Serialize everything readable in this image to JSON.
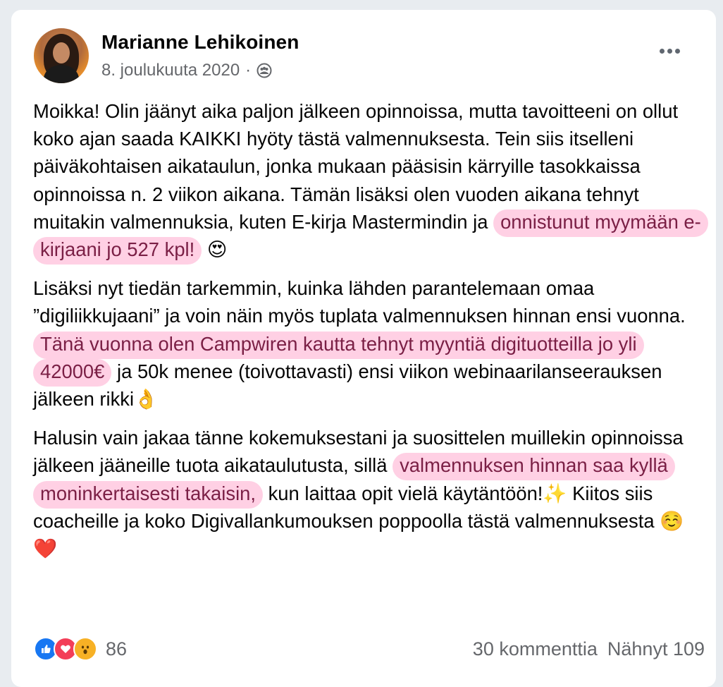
{
  "post": {
    "author": "Marianne Lehikoinen",
    "date": "8. joulukuuta 2020",
    "separator": "·",
    "audience_icon": "group-audience-icon",
    "more_icon": "more-options-icon",
    "paragraphs": [
      {
        "segments": [
          {
            "text": "Moikka! Olin jäänyt aika paljon jälkeen opinnoissa, mutta tavoitteeni on ollut koko ajan saada KAIKKI hyöty tästä valmennuksesta. Tein siis itselleni päiväkohtaisen aikataulun, jonka mukaan pääsisin kärryille tasokkaissa opinnoissa n. 2 viikon aikana. Tämän lisäksi olen vuoden aikana tehnyt muitakin valmennuksia, kuten E-kirja Mastermindin ja "
          },
          {
            "text": "onnistunut myymään e-kirjaani jo 527 kpl!",
            "highlight": true
          },
          {
            "text": " 😍"
          }
        ]
      },
      {
        "segments": [
          {
            "text": "Lisäksi nyt tiedän tarkemmin, kuinka lähden parantelemaan omaa ”digiliikkujaani” ja voin näin myös tuplata valmennuksen hinnan ensi vuonna. "
          },
          {
            "text": "Tänä vuonna olen Campwiren kautta tehnyt myyntiä digituotteilla jo yli 42000€",
            "highlight": true
          },
          {
            "text": " ja 50k menee (toivottavasti) ensi viikon webinaarilanseerauksen jälkeen rikki👌"
          }
        ]
      },
      {
        "segments": [
          {
            "text": "Halusin vain jakaa tänne kokemuksestani ja suosittelen muillekin opinnoissa jälkeen jääneille tuota aikataulutusta, sillä "
          },
          {
            "text": "valmennuksen hinnan saa kyllä moninkertaisesti takaisin,",
            "highlight": true
          },
          {
            "text": " kun laittaa opit vielä käytäntöön!✨ Kiitos siis coacheille ja koko Digivallankumouksen poppoolla tästä valmennuksesta ☺️❤️"
          }
        ]
      }
    ],
    "reactions": {
      "icons": [
        "like-icon",
        "love-icon",
        "wow-icon"
      ],
      "count": "86"
    },
    "comments": "30 kommenttia",
    "seen": "Nähnyt 109"
  },
  "colors": {
    "highlight_bg": "#ffaacd",
    "highlight_text": "#7a1f45",
    "like": "#1877f2",
    "love": "#f33e58",
    "wow": "#f7b125",
    "secondary_text": "#65676b"
  }
}
